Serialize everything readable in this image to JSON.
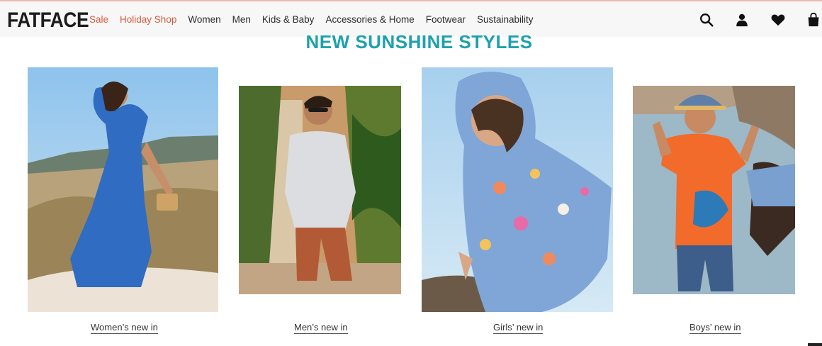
{
  "brand": {
    "logo_text": "FATFACE"
  },
  "nav": {
    "items": [
      {
        "label": "Sale",
        "highlight": true
      },
      {
        "label": "Holiday Shop",
        "highlight": true
      },
      {
        "label": "Women",
        "highlight": false
      },
      {
        "label": "Men",
        "highlight": false
      },
      {
        "label": "Kids & Baby",
        "highlight": false
      },
      {
        "label": "Accessories & Home",
        "highlight": false
      },
      {
        "label": "Footwear",
        "highlight": false
      },
      {
        "label": "Sustainability",
        "highlight": false
      }
    ]
  },
  "header_icons": [
    "search-icon",
    "account-icon",
    "wishlist-heart-icon",
    "bag-icon"
  ],
  "promo": {
    "title": "NEW SUNSHINE STYLES",
    "cards": [
      {
        "caption": "Women’s new in"
      },
      {
        "caption": "Men’s new in"
      },
      {
        "caption": "Girls’ new in"
      },
      {
        "caption": "Boys’ new in"
      }
    ]
  },
  "colors": {
    "accent_teal": "#1ea1ad",
    "sale_orange": "#d85a3c",
    "header_bg": "#f7f7f7"
  }
}
